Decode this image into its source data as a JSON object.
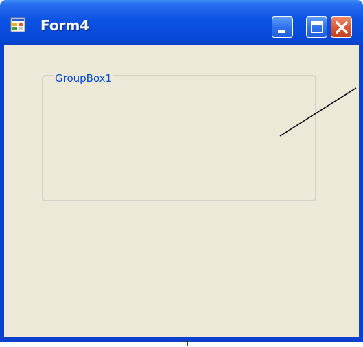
{
  "window": {
    "title": "Form4",
    "icon": "form-app-icon",
    "controls": {
      "minimize_icon": "minimize-icon",
      "maximize_icon": "maximize-icon",
      "close_icon": "close-icon"
    }
  },
  "groupbox": {
    "caption": "GroupBox1"
  },
  "colors": {
    "titlebar": "#0b52e3",
    "client_background": "#ece9d8",
    "groupbox_caption": "#0046d5",
    "close_button": "#d95533"
  }
}
